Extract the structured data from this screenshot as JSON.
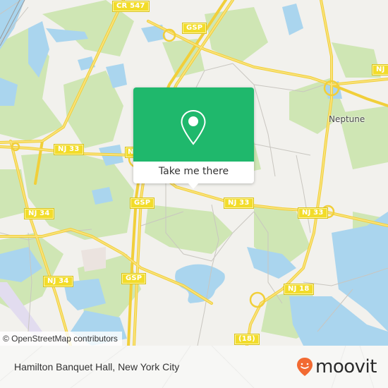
{
  "map": {
    "labels": {
      "road_shields": [
        {
          "id": "cr547",
          "text": "CR 547"
        },
        {
          "id": "gsp-top",
          "text": "GSP"
        },
        {
          "id": "nj-ne",
          "text": "NJ"
        },
        {
          "id": "nj33-west",
          "text": "NJ 33"
        },
        {
          "id": "nj33-center",
          "text": "NJ 33"
        },
        {
          "id": "nj33-east",
          "text": "NJ 33"
        },
        {
          "id": "nj-partial",
          "text": "NJ"
        },
        {
          "id": "gsp-mid",
          "text": "GSP"
        },
        {
          "id": "nj34-west",
          "text": "NJ 34"
        },
        {
          "id": "nj34-south",
          "text": "NJ 34"
        },
        {
          "id": "gsp-south",
          "text": "GSP"
        },
        {
          "id": "nj18",
          "text": "NJ 18"
        },
        {
          "id": "r18",
          "text": "(18)"
        }
      ],
      "places": [
        {
          "id": "neptune",
          "text": "Neptune"
        }
      ]
    },
    "attribution": "© OpenStreetMap contributors",
    "colors": {
      "land": "#f2f1ed",
      "park": "#cde6b0",
      "water": "#a9d6ef",
      "road": "#f6d84a",
      "popup": "#1fb86c",
      "brand": "#f26a32"
    }
  },
  "popup": {
    "icon": "map-pin-icon",
    "button_label": "Take me there"
  },
  "footer": {
    "title": "Hamilton Banquet Hall, New York City",
    "logo_text": "moovit",
    "logo_icon": "moovit-smile-pin-icon"
  }
}
